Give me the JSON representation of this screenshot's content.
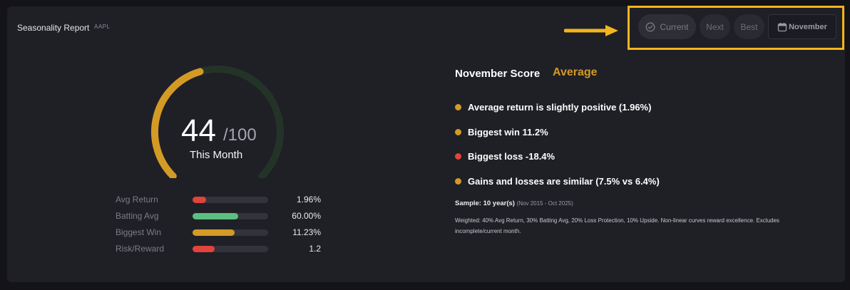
{
  "header": {
    "title": "Seasonality Report",
    "ticker": "AAPL"
  },
  "toolbar": {
    "current_label": "Current",
    "next_label": "Next",
    "best_label": "Best",
    "month_label": "November"
  },
  "gauge": {
    "score": "44",
    "denominator": "/100",
    "label": "This Month",
    "fraction": 0.44
  },
  "metrics": [
    {
      "label": "Avg Return",
      "value": "1.96%",
      "fill": 0.18,
      "color": "#e0443a"
    },
    {
      "label": "Batting Avg",
      "value": "60.00%",
      "fill": 0.6,
      "color": "#5bbf7f"
    },
    {
      "label": "Biggest Win",
      "value": "11.23%",
      "fill": 0.56,
      "color": "#d49a26"
    },
    {
      "label": "Risk/Reward",
      "value": "1.2",
      "fill": 0.29,
      "color": "#e0443a"
    }
  ],
  "summary": {
    "heading": "November Score",
    "rating": "Average",
    "insights": [
      {
        "text": "Average return is slightly positive (1.96%)",
        "color": "#d49a26"
      },
      {
        "text": "Biggest win 11.2%",
        "color": "#d49a26"
      },
      {
        "text": "Biggest loss -18.4%",
        "color": "#e0443a"
      },
      {
        "text": "Gains and losses are similar (7.5% vs 6.4%)",
        "color": "#d49a26"
      }
    ],
    "sample": "Sample: 10 year(s)",
    "sample_range": "(Nov 2015 - Oct 2025)",
    "weighted": "Weighted: 40% Avg Return, 30% Batting Avg, 20% Loss Protection, 10% Upside. Non-linear curves reward excellence. Excludes incomplete/current month."
  },
  "colors": {
    "accent": "#d49a26",
    "highlight": "#f3b51c",
    "negative": "#e0443a",
    "positive": "#5bbf7f"
  }
}
